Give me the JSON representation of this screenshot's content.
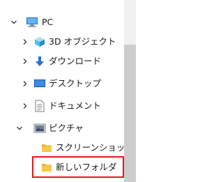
{
  "nav_tree": {
    "items": [
      {
        "label": "PC",
        "icon": "pc-icon",
        "expanded": true
      },
      {
        "label": "3D オブジェクト",
        "icon": "3d-objects-icon",
        "expanded": false
      },
      {
        "label": "ダウンロード",
        "icon": "download-arrow-icon",
        "expanded": false
      },
      {
        "label": "デスクトップ",
        "icon": "desktop-icon",
        "expanded": false
      },
      {
        "label": "ドキュメント",
        "icon": "document-icon",
        "expanded": false
      },
      {
        "label": "ピクチャ",
        "icon": "pictures-icon",
        "expanded": true
      },
      {
        "label": "スクリーンショット",
        "icon": "folder-icon"
      },
      {
        "label": "新しいフォルダ",
        "icon": "folder-icon",
        "highlighted": true
      }
    ]
  },
  "colors": {
    "highlight_border": "#e0191e",
    "folder_yellow": "#f6c94a",
    "download_blue": "#2a6fd6"
  }
}
